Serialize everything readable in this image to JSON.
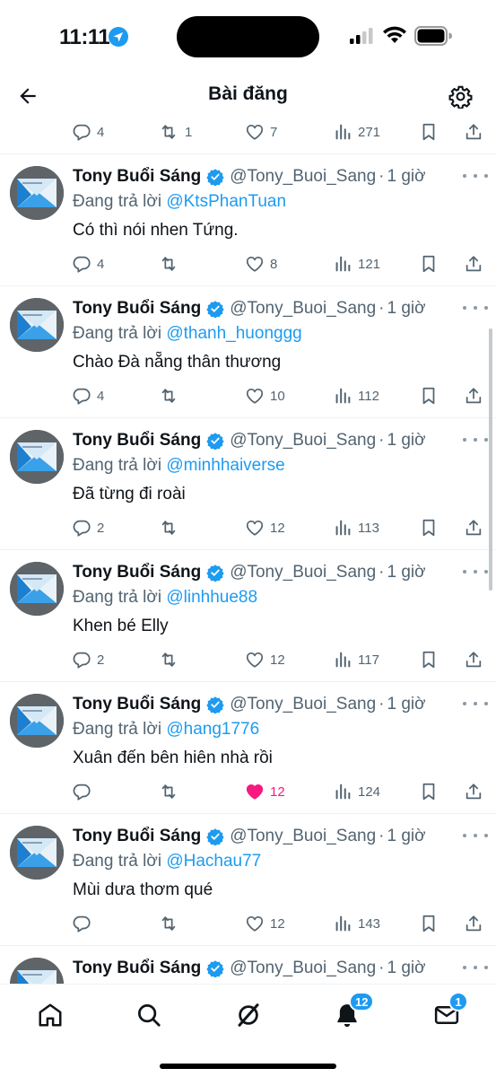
{
  "status": {
    "time": "11:11"
  },
  "header": {
    "title": "Bài đăng"
  },
  "prev_tweet": {
    "replies": "4",
    "retweets": "1",
    "likes": "7",
    "views": "271"
  },
  "tweets": [
    {
      "author": "Tony Buổi Sáng",
      "handle": "@Tony_Buoi_Sang",
      "time": "1 giờ",
      "reply_prefix": "Đang trả lời",
      "reply_to": "@KtsPhanTuan",
      "text": "Có thì nói nhen Tứng.",
      "replies": "4",
      "retweets": "",
      "likes": "8",
      "views": "121",
      "liked": false
    },
    {
      "author": "Tony Buổi Sáng",
      "handle": "@Tony_Buoi_Sang",
      "time": "1 giờ",
      "reply_prefix": "Đang trả lời",
      "reply_to": "@thanh_huonggg",
      "text": "Chào Đà nẵng thân thương",
      "replies": "4",
      "retweets": "",
      "likes": "10",
      "views": "112",
      "liked": false
    },
    {
      "author": "Tony Buổi Sáng",
      "handle": "@Tony_Buoi_Sang",
      "time": "1 giờ",
      "reply_prefix": "Đang trả lời",
      "reply_to": "@minhhaiverse",
      "text": "Đã từng đi roài",
      "replies": "2",
      "retweets": "",
      "likes": "12",
      "views": "113",
      "liked": false
    },
    {
      "author": "Tony Buổi Sáng",
      "handle": "@Tony_Buoi_Sang",
      "time": "1 giờ",
      "reply_prefix": "Đang trả lời",
      "reply_to": "@linhhue88",
      "text": "Khen bé Elly",
      "replies": "2",
      "retweets": "",
      "likes": "12",
      "views": "117",
      "liked": false
    },
    {
      "author": "Tony Buổi Sáng",
      "handle": "@Tony_Buoi_Sang",
      "time": "1 giờ",
      "reply_prefix": "Đang trả lời",
      "reply_to": "@hang1776",
      "text": "Xuân đến bên hiên nhà rồi",
      "replies": "",
      "retweets": "",
      "likes": "12",
      "views": "124",
      "liked": true
    },
    {
      "author": "Tony Buổi Sáng",
      "handle": "@Tony_Buoi_Sang",
      "time": "1 giờ",
      "reply_prefix": "Đang trả lời",
      "reply_to": "@Hachau77",
      "text": "Mùi dưa thơm qué",
      "replies": "",
      "retweets": "",
      "likes": "12",
      "views": "143",
      "liked": false
    },
    {
      "author": "Tony Buổi Sáng",
      "handle": "@Tony_Buoi_Sang",
      "time": "1 giờ",
      "reply_prefix": "",
      "reply_to": "",
      "text": "",
      "replies": "",
      "retweets": "",
      "likes": "",
      "views": "",
      "liked": false
    }
  ],
  "nav": {
    "items": [
      {
        "name": "home",
        "icon": "home-icon"
      },
      {
        "name": "search",
        "icon": "search-icon"
      },
      {
        "name": "grok",
        "icon": "grok-icon"
      },
      {
        "name": "notifications",
        "icon": "bell-icon",
        "badge": "12"
      },
      {
        "name": "messages",
        "icon": "mail-icon",
        "badge": "1"
      }
    ]
  },
  "colors": {
    "accent": "#1d9bf0",
    "like": "#f91880",
    "secondary_text": "#536471"
  }
}
